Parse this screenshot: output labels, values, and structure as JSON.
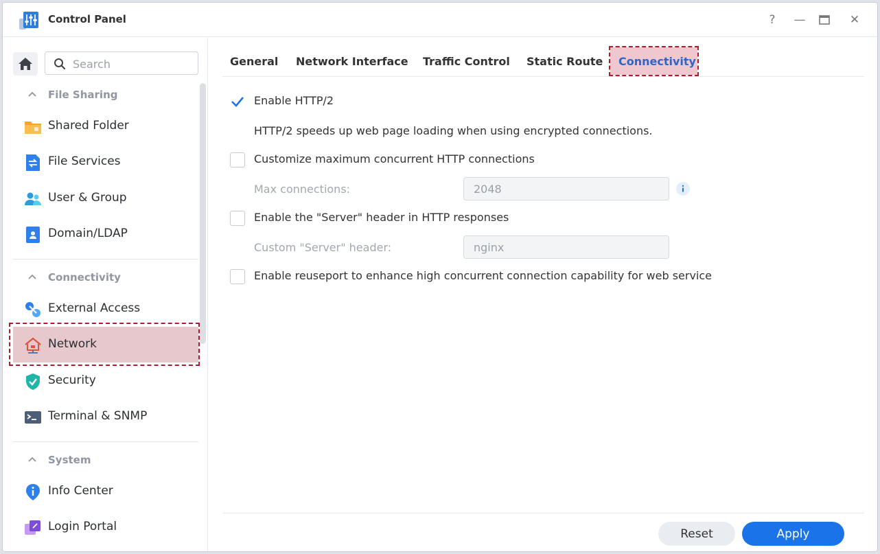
{
  "window": {
    "title": "Control Panel",
    "help": "?",
    "minimize": "—",
    "maximize": "▭",
    "close": "✕"
  },
  "search": {
    "placeholder": "Search"
  },
  "sidebar": {
    "sections": [
      {
        "label": "File Sharing",
        "items": [
          "Shared Folder",
          "File Services",
          "User & Group",
          "Domain/LDAP"
        ]
      },
      {
        "label": "Connectivity",
        "items": [
          "External Access",
          "Network",
          "Security",
          "Terminal & SNMP"
        ]
      },
      {
        "label": "System",
        "items": [
          "Info Center",
          "Login Portal"
        ]
      }
    ],
    "active_item": "Network"
  },
  "tabs": [
    "General",
    "Network Interface",
    "Traffic Control",
    "Static Route",
    "Connectivity"
  ],
  "active_tab": "Connectivity",
  "options": {
    "http2": {
      "label": "Enable HTTP/2",
      "checked": true,
      "description": "HTTP/2 speeds up web page loading when using encrypted connections."
    },
    "max_conn": {
      "label": "Customize maximum concurrent HTTP connections",
      "checked": false,
      "field_label": "Max connections:",
      "field_value": "2048"
    },
    "server_header": {
      "label": "Enable the \"Server\" header in HTTP responses",
      "checked": false,
      "field_label": "Custom \"Server\" header:",
      "field_value": "nginx"
    },
    "reuseport": {
      "label": "Enable reuseport to enhance high concurrent connection capability for web service",
      "checked": false
    }
  },
  "buttons": {
    "reset": "Reset",
    "apply": "Apply"
  },
  "colors": {
    "accent": "#1a73e8",
    "highlight_border": "#b01a2c",
    "highlight_fill": "#e7c8cd"
  }
}
